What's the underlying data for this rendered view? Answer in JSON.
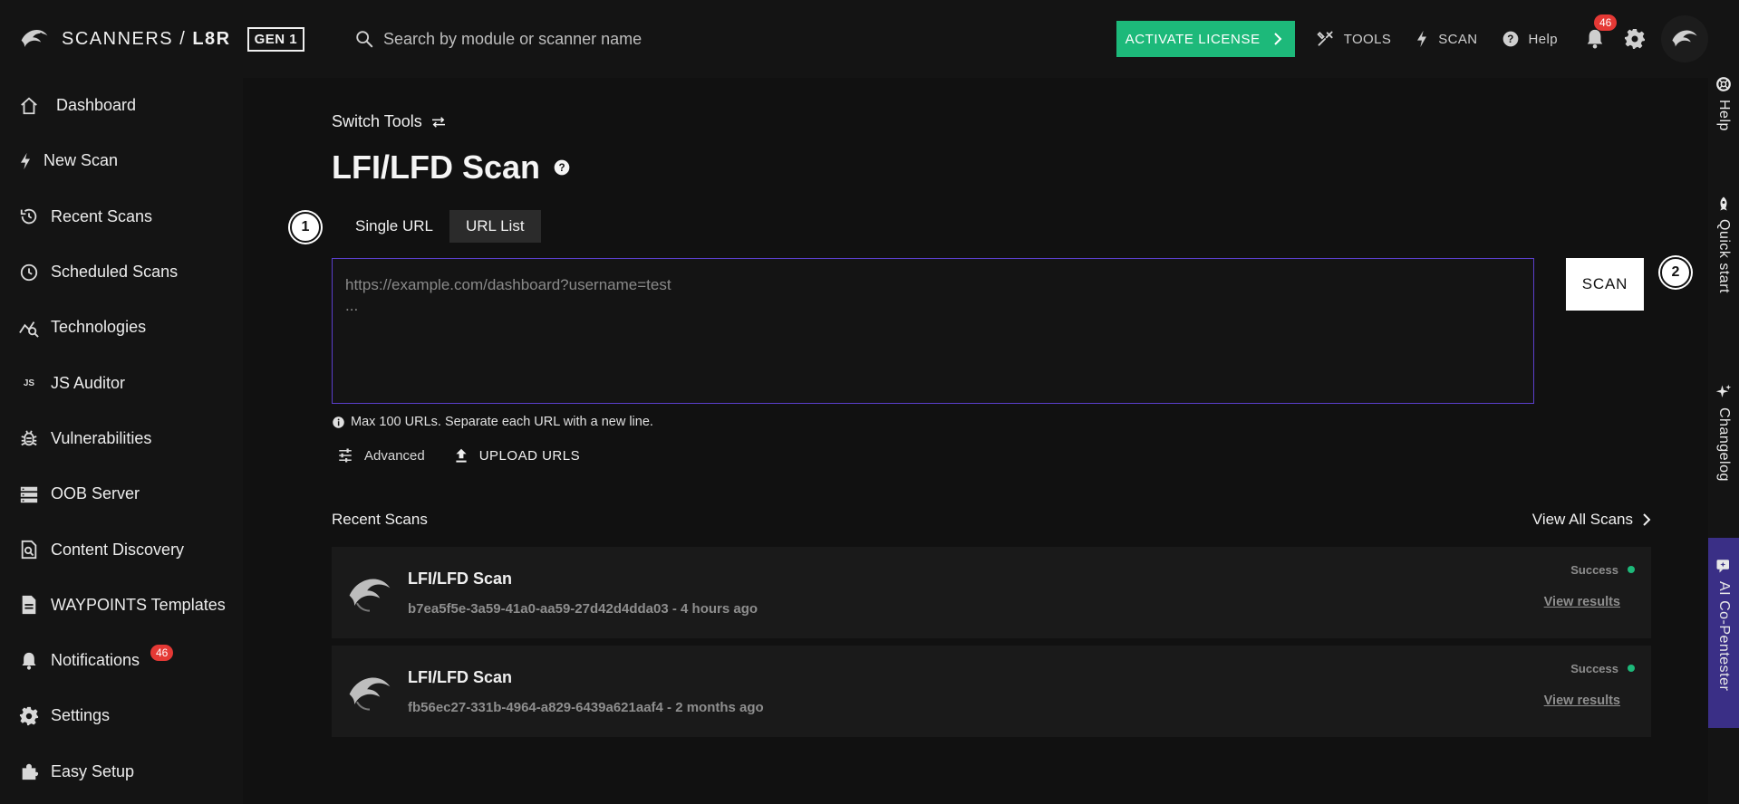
{
  "header": {
    "brand_name": "SCANNERS / ",
    "brand_bold": "L8R",
    "gen_badge": "GEN 1",
    "search_placeholder": "Search by module or scanner name",
    "activate_label": "ACTIVATE LICENSE",
    "tools_label": "TOOLS",
    "scan_label": "SCAN",
    "help_label": "Help",
    "notification_count": "46"
  },
  "sidebar": {
    "items": [
      {
        "label": "Dashboard",
        "icon": "home-icon"
      },
      {
        "label": "New Scan",
        "icon": "bolt-icon"
      },
      {
        "label": "Recent Scans",
        "icon": "history-icon"
      },
      {
        "label": "Scheduled Scans",
        "icon": "clock-icon"
      },
      {
        "label": "Technologies",
        "icon": "chart-search-icon"
      },
      {
        "label": "JS Auditor",
        "icon": "js-icon"
      },
      {
        "label": "Vulnerabilities",
        "icon": "bug-icon"
      },
      {
        "label": "OOB Server",
        "icon": "server-icon"
      },
      {
        "label": "Content Discovery",
        "icon": "document-search-icon"
      },
      {
        "label": "WAYPOINTS Templates",
        "icon": "file-icon"
      },
      {
        "label": "Notifications",
        "icon": "bell-icon",
        "badge": "46"
      },
      {
        "label": "Settings",
        "icon": "gear-icon"
      },
      {
        "label": "Easy Setup",
        "icon": "puzzle-icon"
      }
    ]
  },
  "main": {
    "switch_tools": "Switch Tools",
    "title": "LFI/LFD Scan",
    "step1": "1",
    "step2": "2",
    "tabs": [
      {
        "label": "Single URL",
        "active": false
      },
      {
        "label": "URL List",
        "active": true
      }
    ],
    "url_placeholder": "https://example.com/dashboard?username=test\n...",
    "url_value": "",
    "scan_button": "SCAN",
    "hint": "Max 100 URLs. Separate each URL with a new line.",
    "advanced_label": "Advanced",
    "upload_label": "UPLOAD URLS"
  },
  "recent": {
    "title": "Recent Scans",
    "view_all": "View All Scans",
    "scans": [
      {
        "name": "LFI/LFD Scan",
        "meta": "b7ea5f5e-3a59-41a0-aa59-27d42d4dda03 - 4 hours ago",
        "status": "Success",
        "link": "View results"
      },
      {
        "name": "LFI/LFD Scan",
        "meta": "fb56ec27-331b-4964-a829-6439a621aaf4 - 2 months ago",
        "status": "Success",
        "link": "View results"
      }
    ]
  },
  "rail": {
    "help": "Help",
    "quick_start": "Quick start",
    "changelog": "Changelog",
    "ai": "AI Co-Pentester"
  },
  "colors": {
    "accent_green": "#1db97a",
    "accent_purple": "#5b3fcc",
    "badge_red": "#e53935"
  }
}
